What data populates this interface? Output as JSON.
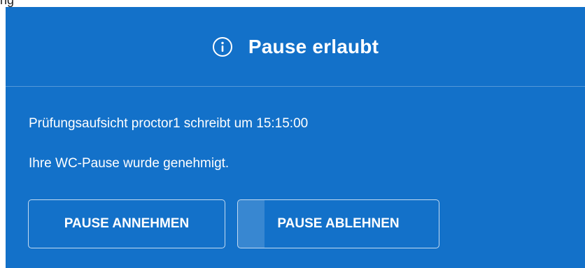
{
  "corner_label": "ng",
  "dialog": {
    "icon": "info-icon",
    "title": "Pause erlaubt",
    "messages": [
      "Prüfungsaufsicht proctor1 schreibt um 15:15:00",
      "Ihre WC-Pause wurde genehmigt."
    ],
    "buttons": {
      "accept_label": "PAUSE ANNEHMEN",
      "decline_label": "PAUSE ABLEHNEN"
    }
  },
  "colors": {
    "dialog_background": "#1371c9",
    "text": "#ffffff"
  }
}
